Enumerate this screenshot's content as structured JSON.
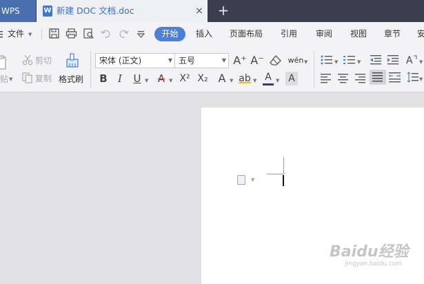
{
  "titlebar": {
    "app_tab": "WPS",
    "doc_tab_icon": "W",
    "doc_title": "新建 DOC 文档.doc",
    "close_glyph": "×",
    "new_tab_glyph": "+"
  },
  "menubar": {
    "file_label": "文件",
    "file_menu_icon": "hamburger-menu-icon",
    "quick_icons": [
      "save-icon",
      "print-icon",
      "print-preview-icon",
      "undo-icon",
      "redo-icon",
      "customize-dropdown-icon"
    ],
    "tabs": [
      {
        "label": "开始",
        "active": true
      },
      {
        "label": "插入"
      },
      {
        "label": "页面布局"
      },
      {
        "label": "引用"
      },
      {
        "label": "审阅"
      },
      {
        "label": "视图"
      },
      {
        "label": "章节"
      },
      {
        "label": "安"
      }
    ]
  },
  "ribbon": {
    "paste_label": "贴",
    "cut_label": "剪切",
    "copy_label": "复制",
    "format_painter_label": "格式刷",
    "font_name": "宋体 (正文)",
    "font_size": "五号",
    "grow_font": "A⁺",
    "shrink_font": "A⁻",
    "pinyin_glyph": "wén",
    "bold": "B",
    "italic": "I",
    "underline": "U",
    "strike": "A",
    "superscript": "X²",
    "subscript": "X₂",
    "text_effect": "A",
    "highlight": "ab",
    "font_color": "A",
    "char_shading": "A",
    "accent_color": "#4b7fd8",
    "font_color_bar": "#1f3a9e"
  },
  "document": {
    "watermark_main": "Baidu经验",
    "watermark_sub": "jingyan.baidu.com"
  }
}
